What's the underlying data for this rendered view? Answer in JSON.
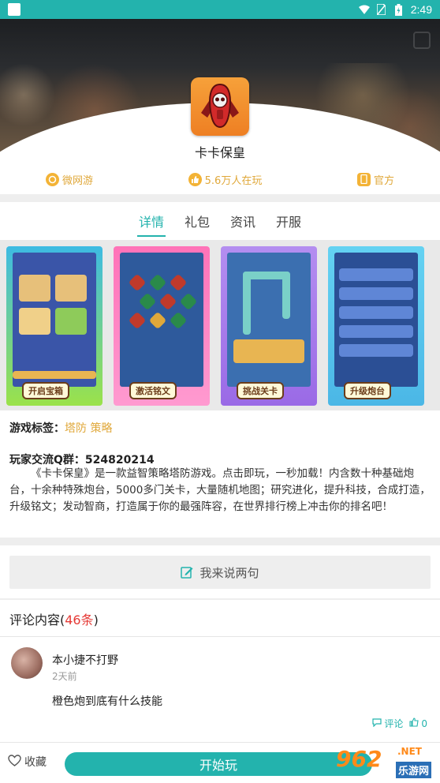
{
  "status_bar": {
    "time": "2:49"
  },
  "app": {
    "name": "卡卡保皇"
  },
  "info": [
    {
      "label": "微网游",
      "icon": "gamepad-icon"
    },
    {
      "label": "5.6万人在玩",
      "icon": "thumb-icon"
    },
    {
      "label": "官方",
      "icon": "phone-icon"
    }
  ],
  "tabs": [
    "详情",
    "礼包",
    "资讯",
    "开服"
  ],
  "screenshots": [
    {
      "caption": "开启宝箱"
    },
    {
      "caption": "激活铭文"
    },
    {
      "caption": "挑战关卡"
    },
    {
      "caption": "升级炮台"
    }
  ],
  "tags": {
    "label": "游戏标签：",
    "value": "塔防 策略"
  },
  "qq_group": "玩家交流Q群：524820214",
  "description": "《卡卡保皇》是一款益智策略塔防游戏。点击即玩，一秒加载！内含数十种基础炮台，十余种特殊炮台，5000多门关卡，大量随机地图；研究进化，提升科技，合成打造，升级铭文；发动智商，打造属于你的最强阵容，在世界排行榜上冲击你的排名吧！",
  "comment_button": "我来说两句",
  "comments_header": {
    "title": "评论内容(",
    "count": "46条",
    "close": ")"
  },
  "comment": {
    "user": "本小捷不打野",
    "time": "2天前",
    "text": "橙色炮到底有什么技能",
    "reply_label": "评论",
    "likes": "0"
  },
  "bottom": {
    "favorite": "收藏",
    "start": "开始玩"
  },
  "watermark": {
    "number": "962",
    "domain": ".NET",
    "site": "乐游网"
  },
  "colors": {
    "accent": "#23b3ad",
    "highlight": "#e0a83a",
    "count": "#e53935"
  }
}
